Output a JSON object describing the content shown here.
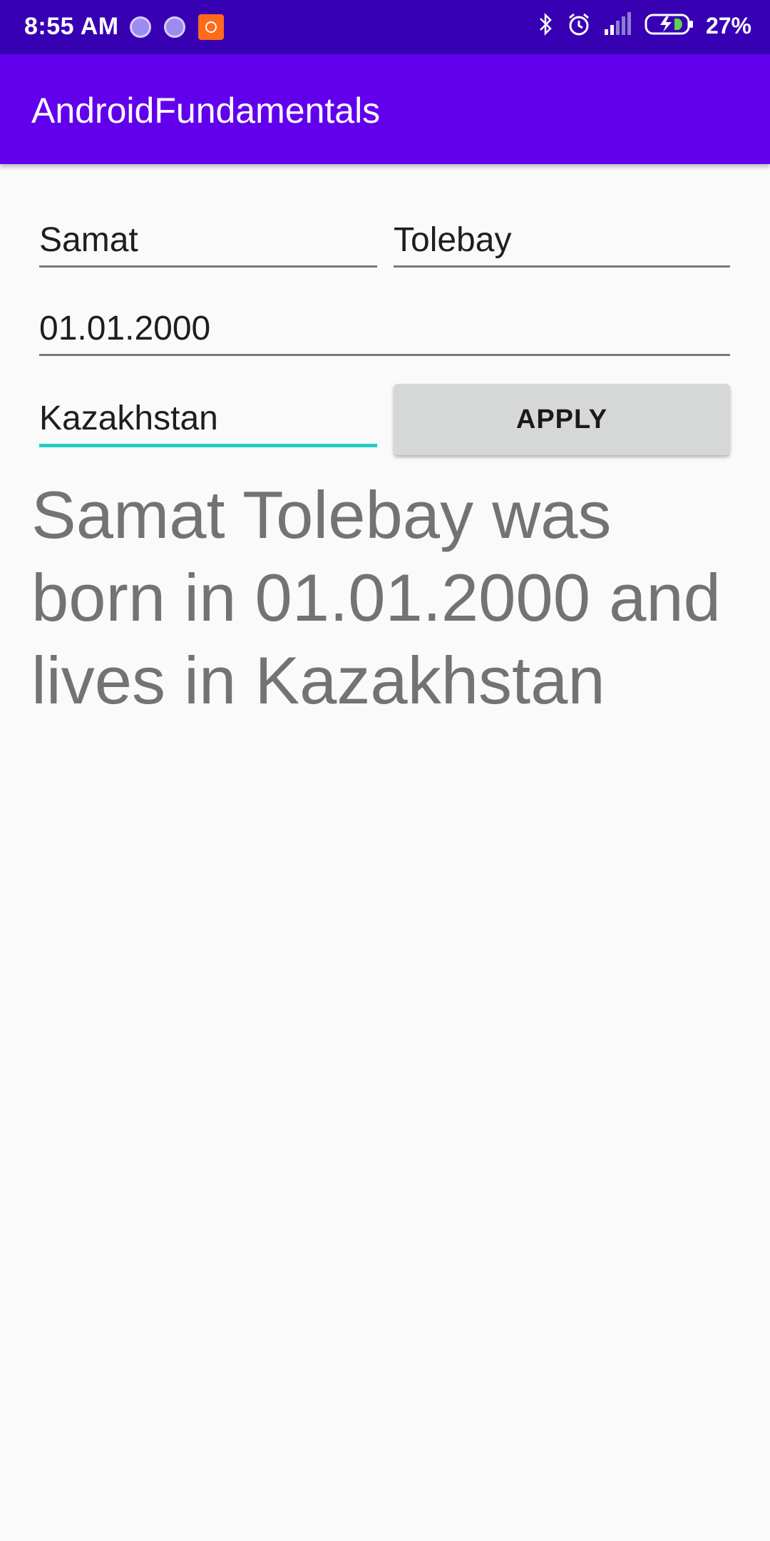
{
  "status_bar": {
    "time": "8:55 AM",
    "battery": "27%",
    "icons": [
      "notification-dot-icon",
      "notification-dot-icon",
      "mi-app-icon",
      "bluetooth-icon",
      "alarm-icon",
      "signal-icon",
      "battery-charging-icon"
    ]
  },
  "app_bar": {
    "title": "AndroidFundamentals"
  },
  "form": {
    "first_name": "Samat",
    "last_name": "Tolebay",
    "birth_date": "01.01.2000",
    "country": "Kazakhstan",
    "apply_label": "APPLY"
  },
  "result_text": "Samat Tolebay was born in 01.01.2000 and lives in Kazakhstan",
  "colors": {
    "status_bar": "#3700b3",
    "app_bar": "#6200ee",
    "focus_accent": "#1fcfbf",
    "button": "#d6d7d7"
  }
}
